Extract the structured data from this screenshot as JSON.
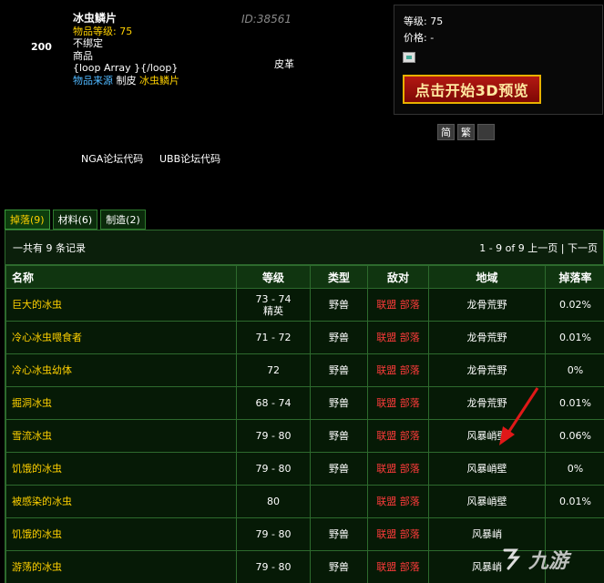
{
  "item": {
    "count": "200",
    "name": "冰虫鳞片",
    "level": "物品等级: 75",
    "bind": "不绑定",
    "kind": "商品",
    "loop": "{loop Array }{/loop}",
    "id": "ID:38561",
    "skin": "皮革",
    "source_label": "物品来源",
    "source_prof": "制皮",
    "source_item": "冰虫鳞片"
  },
  "stats": {
    "level": "等级: 75",
    "price": "价格: -"
  },
  "preview_button": "点击开始3D预览",
  "lang": {
    "simplified": "简",
    "traditional": "繁"
  },
  "codes": {
    "nga": "NGA论坛代码",
    "ubb": "UBB论坛代码"
  },
  "tabs": [
    {
      "label": "掉落(9)"
    },
    {
      "label": "材料(6)"
    },
    {
      "label": "制造(2)"
    }
  ],
  "summary": {
    "total": "一共有 9 条记录",
    "range": "1 - 9 of 9",
    "prev": "上一页",
    "sep": "|",
    "next": "下一页"
  },
  "columns": [
    "名称",
    "等级",
    "类型",
    "敌对",
    "地域",
    "掉落率"
  ],
  "rows": [
    {
      "name": "巨大的冰虫",
      "level": "73 - 74",
      "level2": "精英",
      "type": "野兽",
      "a": "联盟",
      "h": "部落",
      "zone": "龙骨荒野",
      "rate": "0.02%"
    },
    {
      "name": "冷心冰虫喂食者",
      "level": "71 - 72",
      "level2": "",
      "type": "野兽",
      "a": "联盟",
      "h": "部落",
      "zone": "龙骨荒野",
      "rate": "0.01%"
    },
    {
      "name": "冷心冰虫幼体",
      "level": "72",
      "level2": "",
      "type": "野兽",
      "a": "联盟",
      "h": "部落",
      "zone": "龙骨荒野",
      "rate": "0%"
    },
    {
      "name": "掘洞冰虫",
      "level": "68 - 74",
      "level2": "",
      "type": "野兽",
      "a": "联盟",
      "h": "部落",
      "zone": "龙骨荒野",
      "rate": "0.01%"
    },
    {
      "name": "雪流冰虫",
      "level": "79 - 80",
      "level2": "",
      "type": "野兽",
      "a": "联盟",
      "h": "部落",
      "zone": "风暴峭壁",
      "rate": "0.06%"
    },
    {
      "name": "饥饿的冰虫",
      "level": "79 - 80",
      "level2": "",
      "type": "野兽",
      "a": "联盟",
      "h": "部落",
      "zone": "风暴峭壁",
      "rate": "0%"
    },
    {
      "name": "被感染的冰虫",
      "level": "80",
      "level2": "",
      "type": "",
      "a": "联盟",
      "h": "部落",
      "zone": "风暴峭壁",
      "rate": "0.01%"
    },
    {
      "name": "饥饿的冰虫",
      "level": "79 - 80",
      "level2": "",
      "type": "野兽",
      "a": "联盟",
      "h": "部落",
      "zone": "风暴峭",
      "rate": ""
    },
    {
      "name": "游荡的冰虫",
      "level": "79 - 80",
      "level2": "",
      "type": "野兽",
      "a": "联盟",
      "h": "部落",
      "zone": "风暴峭",
      "rate": ""
    }
  ],
  "watermark": "九游"
}
